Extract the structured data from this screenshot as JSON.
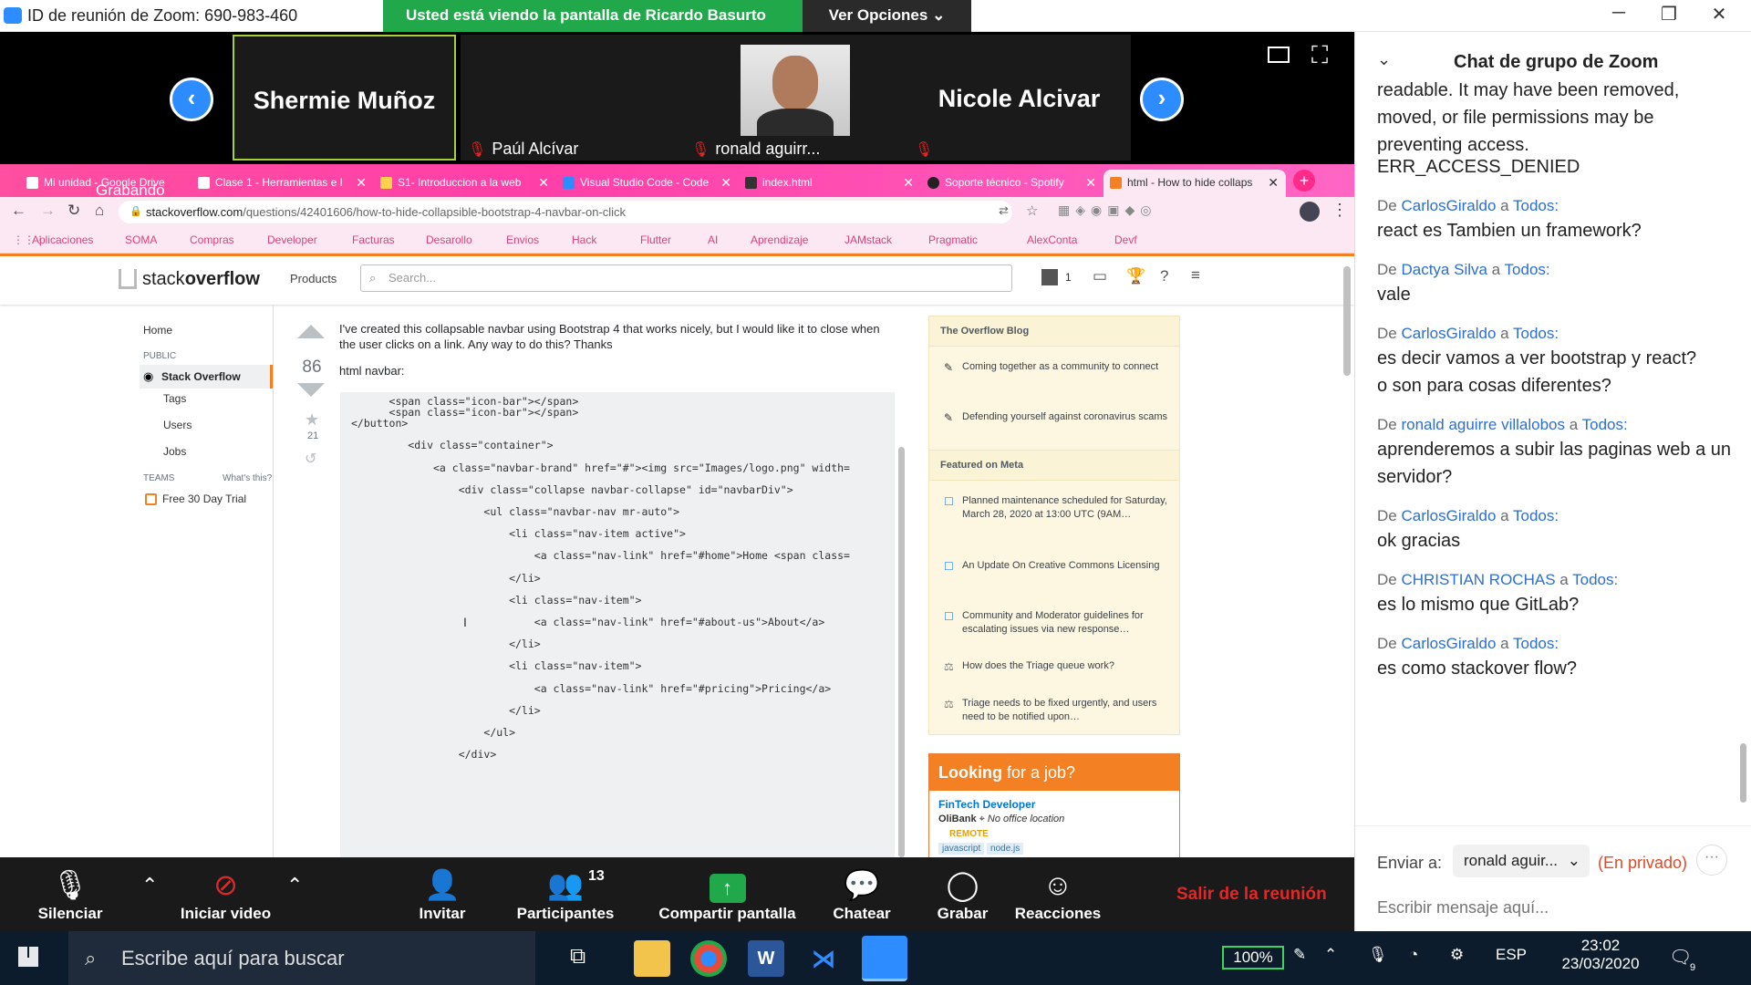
{
  "window": {
    "title": "ID de reunión de Zoom: 690-983-460",
    "share_banner": "Usted está viendo la pantalla de Ricardo Basurto",
    "view_options": "Ver Opciones",
    "minimize": "─",
    "restore": "❐",
    "close": "✕"
  },
  "gallery": {
    "tiles": [
      {
        "name": "Shermie Muñoz",
        "label": ""
      },
      {
        "name": "",
        "label": "Paúl Alcívar"
      },
      {
        "name": "",
        "label": "ronald aguirr..."
      },
      {
        "name": "Nicole Alcivar",
        "label": ""
      }
    ]
  },
  "browser": {
    "recording": "Grabando",
    "tabs": [
      {
        "label": "Mi unidad - Google Drive"
      },
      {
        "label": "Clase 1 - Herramientas e l"
      },
      {
        "label": "S1- Introduccion a la web"
      },
      {
        "label": "Visual Studio Code - Code"
      },
      {
        "label": "index.html"
      },
      {
        "label": "Soporte técnico - Spotify"
      },
      {
        "label": "html - How to hide collaps"
      }
    ],
    "url_host": "stackoverflow.com",
    "url_path": "/questions/42401606/how-to-hide-collapsible-bootstrap-4-navbar-on-click",
    "bookmarks": [
      "Aplicaciones",
      "SOMA",
      "Compras",
      "Developer",
      "Facturas",
      "Desarollo",
      "Envios",
      "Hack",
      "Flutter",
      "AI",
      "Aprendizaje",
      "JAMstack",
      "Pragmatic",
      "AlexConta",
      "Devf"
    ]
  },
  "so": {
    "logo_a": "stack",
    "logo_b": "overflow",
    "products": "Products",
    "search_placeholder": "Search...",
    "rep": "1",
    "side": {
      "home": "Home",
      "public": "PUBLIC",
      "stack_overflow": "Stack Overflow",
      "tags": "Tags",
      "users": "Users",
      "jobs": "Jobs",
      "teams": "TEAMS",
      "whats_this": "What's this?",
      "trial": "Free 30 Day Trial"
    },
    "votes": "86",
    "bookmarks": "21",
    "question": "I've created this collapsable navbar using Bootstrap 4 that works nicely, but I would like it to close when the user clicks on a link. Any way to do this? Thanks",
    "html_navbar": "html navbar:",
    "code": [
      "      <span class=\"icon-bar\"></span>",
      "      <span class=\"icon-bar\"></span>",
      "</button>",
      "",
      "         <div class=\"container\">",
      "",
      "             <a class=\"navbar-brand\" href=\"#\"><img src=\"Images/logo.png\" width=",
      "",
      "                 <div class=\"collapse navbar-collapse\" id=\"navbarDiv\">",
      "",
      "                     <ul class=\"navbar-nav mr-auto\">",
      "",
      "                         <li class=\"nav-item active\">",
      "",
      "                             <a class=\"nav-link\" href=\"#home\">Home <span class=",
      "",
      "                         </li>",
      "",
      "                         <li class=\"nav-item\">",
      "",
      "                             <a class=\"nav-link\" href=\"#about-us\">About</a>",
      "",
      "                         </li>",
      "",
      "                         <li class=\"nav-item\">",
      "",
      "                             <a class=\"nav-link\" href=\"#pricing\">Pricing</a>",
      "",
      "                         </li>",
      "",
      "                     </ul>",
      "",
      "                 </div>"
    ],
    "blog_title": "The Overflow Blog",
    "blog_items": [
      "Coming together as a community to connect",
      "Defending yourself against coronavirus scams"
    ],
    "meta_title": "Featured on Meta",
    "meta_items": [
      "Planned maintenance scheduled for Saturday, March 28, 2020 at 13:00 UTC (9AM…",
      "An Update On Creative Commons Licensing",
      "Community and Moderator guidelines for escalating issues via new response…",
      "How does the Triage queue work?",
      "Triage needs to be fixed urgently, and users need to be notified upon…"
    ],
    "job_header_a": "Looking",
    "job_header_b": "for a job?",
    "job_title": "FinTech Developer",
    "job_company": "OliBank",
    "job_location": "No office location",
    "job_remote": "REMOTE",
    "job_tags": [
      "javascript",
      "node.js"
    ]
  },
  "toolbar": {
    "mute": "Silenciar",
    "video": "Iniciar video",
    "invite": "Invitar",
    "participants": "Participantes",
    "participants_count": "13",
    "share": "Compartir pantalla",
    "chat": "Chatear",
    "record": "Grabar",
    "reactions": "Reacciones",
    "leave": "Salir de la reunión"
  },
  "chat": {
    "title": "Chat de grupo de Zoom",
    "messages_top": [
      "readable. It may have been removed, moved, or file permissions may be preventing access.",
      "ERR_ACCESS_DENIED"
    ],
    "from_word": "De",
    "to_word": "a",
    "messages": [
      {
        "from": "CarlosGiraldo",
        "to": "Todos:",
        "text": [
          "react es Tambien un framework?"
        ]
      },
      {
        "from": "Dactya Silva",
        "to": "Todos:",
        "text": [
          "vale"
        ]
      },
      {
        "from": "CarlosGiraldo",
        "to": "Todos:",
        "text": [
          "es decir vamos a ver bootstrap y react?",
          "o son para cosas diferentes?"
        ]
      },
      {
        "from": "ronald aguirre villalobos",
        "to": "Todos:",
        "text": [
          "aprenderemos a subir las paginas web a un servidor?"
        ]
      },
      {
        "from": "CarlosGiraldo",
        "to": "Todos:",
        "text": [
          "ok gracias"
        ]
      },
      {
        "from": "CHRISTIAN ROCHAS",
        "to": "Todos:",
        "text": [
          "es lo mismo que GitLab?"
        ]
      },
      {
        "from": "CarlosGiraldo",
        "to": "Todos:",
        "text": [
          "es como stackover flow?"
        ]
      }
    ],
    "send_to": "Enviar a:",
    "recipient": "ronald aguir...",
    "private": "(En privado)",
    "input_placeholder": "Escribir mensaje aquí..."
  },
  "taskbar": {
    "search_placeholder": "Escribe aquí para buscar",
    "battery": "100%",
    "lang": "ESP",
    "time": "23:02",
    "date": "23/03/2020",
    "notifications": "9"
  }
}
